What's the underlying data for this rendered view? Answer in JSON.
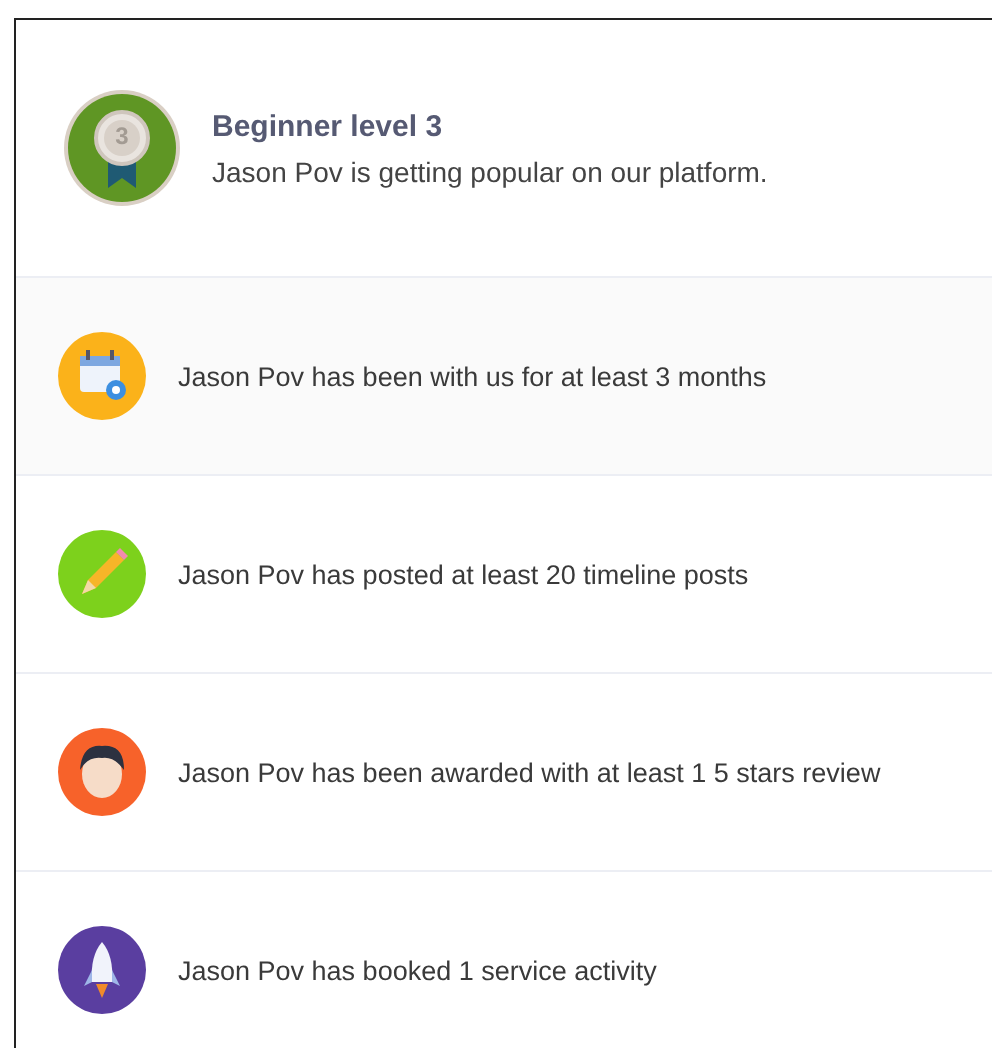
{
  "header": {
    "title": "Beginner level 3",
    "badge_number": "3",
    "description": "Jason Pov is getting popular on our platform."
  },
  "achievements": [
    {
      "kind": "calendar",
      "text": "Jason Pov has been with us for at least 3 months"
    },
    {
      "kind": "pencil",
      "text": "Jason Pov has posted at least 20 timeline posts"
    },
    {
      "kind": "person",
      "text": "Jason Pov has been awarded with at least 1 5 stars review"
    },
    {
      "kind": "rocket",
      "text": "Jason Pov has booked 1 service activity"
    }
  ]
}
